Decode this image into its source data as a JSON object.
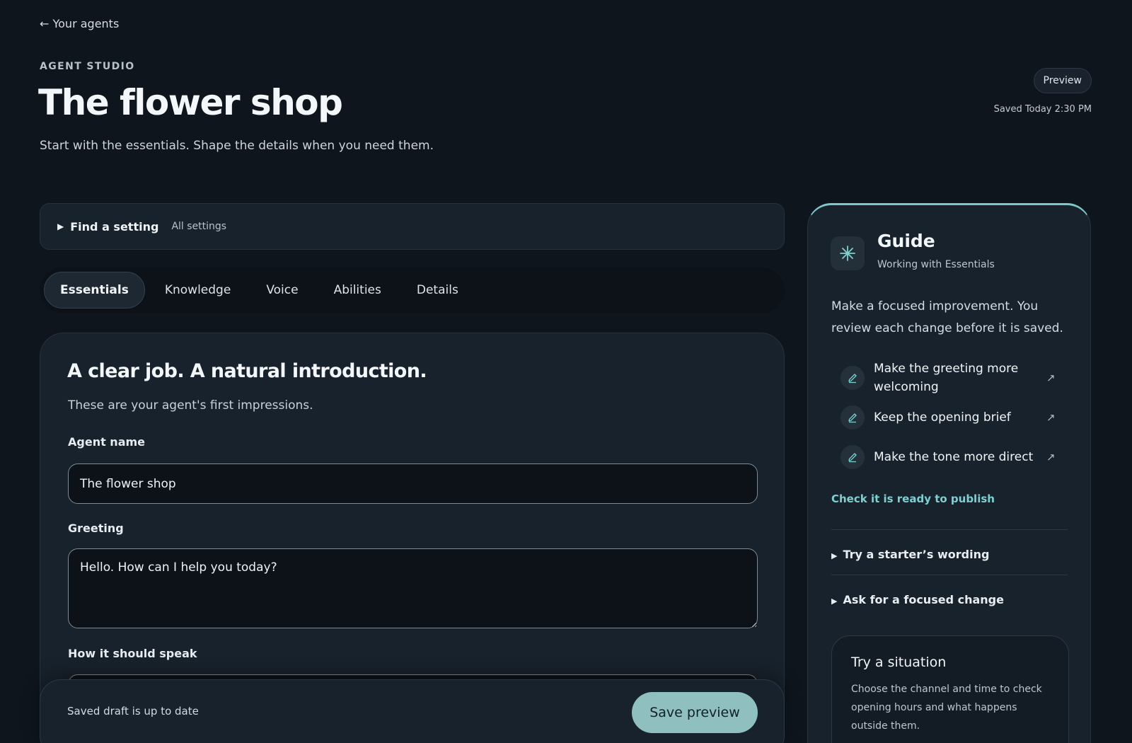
{
  "nav": {
    "back_label": "← Your agents"
  },
  "header": {
    "eyebrow": "AGENT STUDIO",
    "title": "The flower shop",
    "subtitle": "Start with the essentials. Shape the details when you need them.",
    "preview_label": "Preview",
    "saved_status": "Saved Today 2:30 PM"
  },
  "search": {
    "label": "Find a setting",
    "scope": "All settings"
  },
  "tabs": [
    {
      "label": "Essentials",
      "active": true
    },
    {
      "label": "Knowledge",
      "active": false
    },
    {
      "label": "Voice",
      "active": false
    },
    {
      "label": "Abilities",
      "active": false
    },
    {
      "label": "Details",
      "active": false
    }
  ],
  "essentials": {
    "heading": "A clear job. A natural introduction.",
    "subheading": "These are your agent's first impressions.",
    "fields": {
      "agent_name": {
        "label": "Agent name",
        "value": "The flower shop"
      },
      "greeting": {
        "label": "Greeting",
        "value": "Hello. How can I help you today?"
      },
      "speak": {
        "label": "How it should speak"
      }
    }
  },
  "footer": {
    "status": "Saved draft is up to date",
    "save_label": "Save preview"
  },
  "guide": {
    "title": "Guide",
    "subtitle": "Working with Essentials",
    "intro": "Make a focused improvement. You review each change before it is saved.",
    "suggestions": [
      {
        "label": "Make the greeting more welcoming"
      },
      {
        "label": "Keep the opening brief"
      },
      {
        "label": "Make the tone more direct"
      }
    ],
    "ready_link": "Check it is ready to publish",
    "disclosures": [
      {
        "label": "Try a starter’s wording"
      },
      {
        "label": "Ask for a focused change"
      }
    ],
    "situation": {
      "title": "Try a situation",
      "body": "Choose the channel and time to check opening hours and what happens outside them."
    }
  },
  "colors": {
    "background": "#0f151d",
    "surface": "#18222c",
    "accent": "#7fd0d2",
    "primary_button": "#8fbfbf"
  }
}
